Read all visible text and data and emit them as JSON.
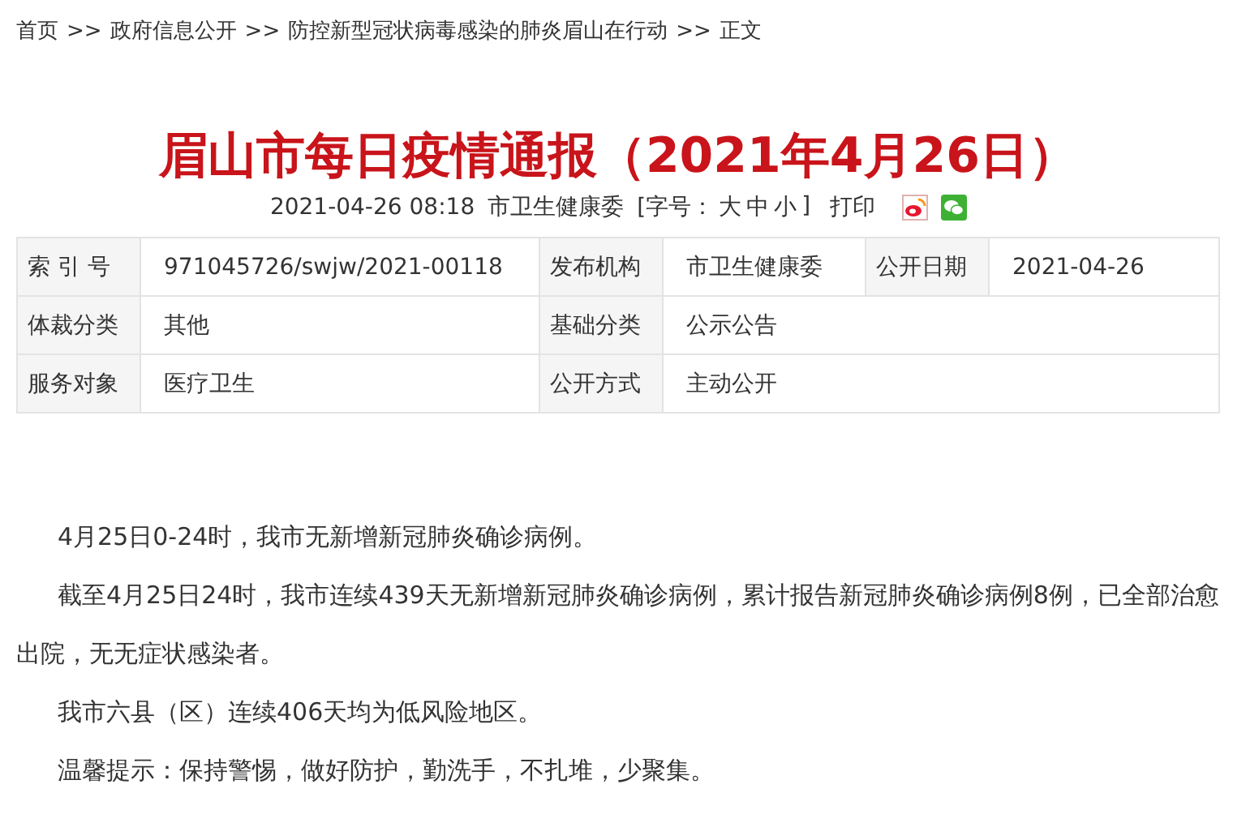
{
  "breadcrumb": {
    "items": [
      "首页",
      "政府信息公开",
      "防控新型冠状病毒感染的肺炎眉山在行动",
      "正文"
    ],
    "separator": ">>"
  },
  "title": "眉山市每日疫情通报（2021年4月26日）",
  "meta": {
    "datetime": "2021-04-26 08:18",
    "source": "市卫生健康委",
    "font_size_prefix": "[字号：",
    "font_sizes": [
      "大",
      "中",
      "小"
    ],
    "font_size_suffix": "]",
    "print": "打印"
  },
  "info_table": {
    "rows": [
      {
        "cells": [
          {
            "label": "索 引 号",
            "value": "971045726/swjw/2021-00118"
          },
          {
            "label": "发布机构",
            "value": "市卫生健康委"
          },
          {
            "label": "公开日期",
            "value": "2021-04-26"
          }
        ]
      },
      {
        "cells": [
          {
            "label": "体裁分类",
            "value": "其他"
          },
          {
            "label": "基础分类",
            "value": "公示公告"
          }
        ]
      },
      {
        "cells": [
          {
            "label": "服务对象",
            "value": "医疗卫生"
          },
          {
            "label": "公开方式",
            "value": "主动公开"
          }
        ]
      }
    ]
  },
  "paragraphs": [
    "4月25日0-24时，我市无新增新冠肺炎确诊病例。",
    "截至4月25日24时，我市连续439天无新增新冠肺炎确诊病例，累计报告新冠肺炎确诊病例8例，已全部治愈出院，无无症状感染者。",
    "我市六县（区）连续406天均为低风险地区。",
    "温馨提示：保持警惕，做好防护，勤洗手，不扎堆，少聚集。"
  ]
}
